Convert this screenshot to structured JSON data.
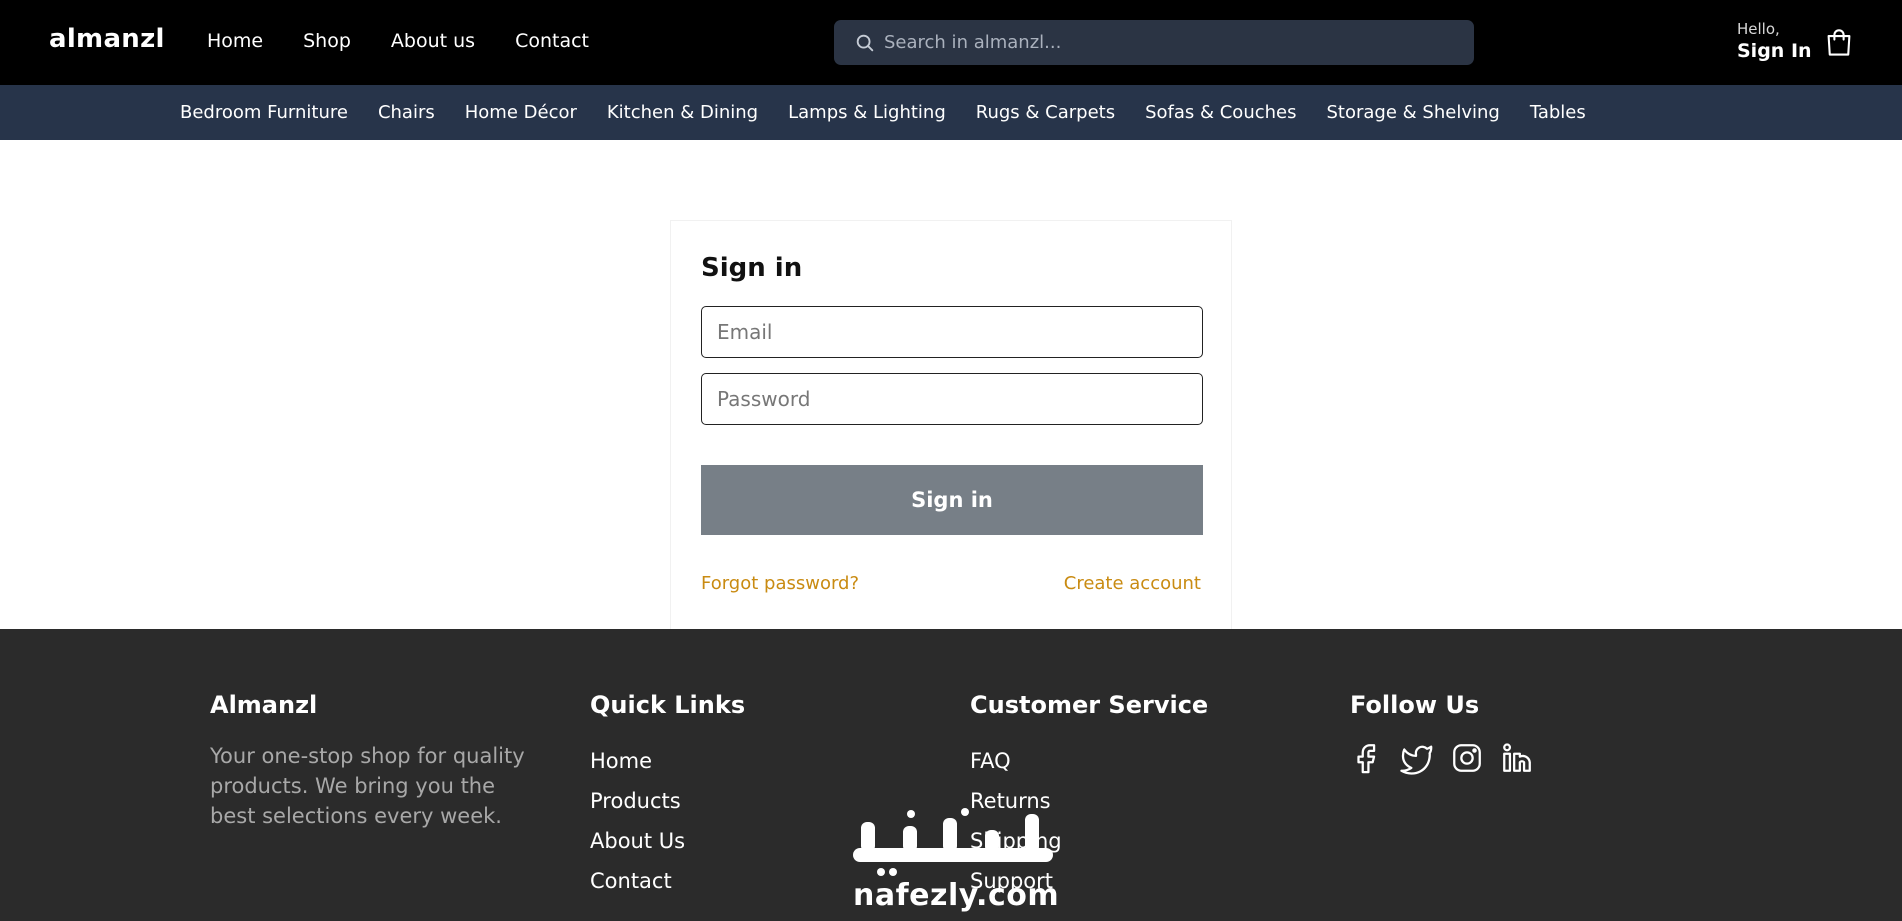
{
  "header": {
    "logo": "almanzl",
    "nav": [
      "Home",
      "Shop",
      "About us",
      "Contact"
    ],
    "search_placeholder": "Search in almanzl...",
    "account": {
      "greeting": "Hello,",
      "action": "Sign In"
    }
  },
  "categories": [
    "Bedroom Furniture",
    "Chairs",
    "Home Décor",
    "Kitchen & Dining",
    "Lamps & Lighting",
    "Rugs & Carpets",
    "Sofas & Couches",
    "Storage & Shelving",
    "Tables"
  ],
  "signin": {
    "title": "Sign in",
    "email_placeholder": "Email",
    "password_placeholder": "Password",
    "button": "Sign in",
    "forgot": "Forgot password?",
    "create": "Create account"
  },
  "footer": {
    "brand": {
      "title": "Almanzl",
      "tagline": "Your one-stop shop for quality products. We bring you the best selections every week."
    },
    "quick_links": {
      "title": "Quick Links",
      "items": [
        "Home",
        "Products",
        "About Us",
        "Contact"
      ]
    },
    "customer_service": {
      "title": "Customer Service",
      "items": [
        "FAQ",
        "Returns",
        "Shipping",
        "Support"
      ]
    },
    "follow": {
      "title": "Follow Us",
      "icons": [
        "facebook-icon",
        "twitter-icon",
        "instagram-icon",
        "linkedin-icon"
      ]
    }
  },
  "watermark": {
    "arabic": "نفذلي",
    "latin": "nafezly.com"
  },
  "colors": {
    "header": "#000000",
    "category_bar": "#27344a",
    "accent_link": "#c98b12",
    "button": "#777f87",
    "footer": "#2b2b2b"
  }
}
